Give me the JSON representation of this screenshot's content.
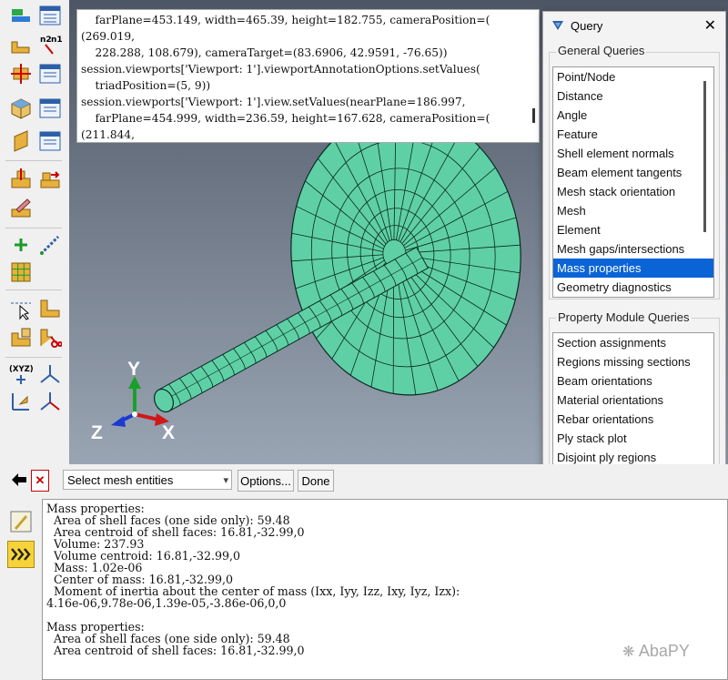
{
  "toolbox": {
    "tools": [
      {
        "icon": "bar-query-icon"
      },
      {
        "icon": "table-report-icon"
      },
      {
        "icon": "datum-csys-icon"
      },
      {
        "icon": "node-label-icon"
      },
      {
        "icon": "measure-point-icon"
      },
      {
        "icon": "table-report-icon"
      },
      {
        "icon": "cube-icon"
      },
      {
        "icon": "table-report-icon"
      },
      {
        "icon": "plate-icon"
      },
      {
        "icon": "table-report-icon"
      },
      {
        "icon": "edit-mesh-icon"
      },
      {
        "icon": "move-mesh-icon"
      },
      {
        "icon": "pencil-mesh-icon"
      },
      {
        "icon": "add-icon"
      },
      {
        "icon": "line-arrow-icon"
      },
      {
        "icon": "grid-mesh-icon"
      },
      {
        "icon": "select-region-icon"
      },
      {
        "icon": "partition-icon"
      },
      {
        "icon": "assign-icon"
      },
      {
        "icon": "cut-icon"
      },
      {
        "icon": "xyz-point-icon"
      },
      {
        "icon": "triad-icon"
      },
      {
        "icon": "axes-transform-icon"
      },
      {
        "icon": "triad-red-icon"
      }
    ],
    "node_label": "n2 n1"
  },
  "replay": {
    "lines": [
      "    farPlane=453.149, width=465.39, height=182.755, cameraPosition=(",
      "(269.019,",
      "    228.288, 108.679), cameraTarget=(83.6906, 42.9591, -76.65))",
      "session.viewports['Viewport: 1'].viewportAnnotationOptions.setValues(",
      "    triadPosition=(5, 9))",
      "session.viewports['Viewport: 1'].view.setValues(nearPlane=186.997,",
      "    farPlane=454.999, width=236.59, height=167.628, cameraPosition=(",
      "(211.844,"
    ]
  },
  "triad": {
    "y": "Y",
    "z": "Z",
    "x": "X"
  },
  "query_dialog": {
    "title": "Query",
    "close": "✕",
    "general_label": "General Queries",
    "general_items": [
      "Point/Node",
      "Distance",
      "Angle",
      "Feature",
      "Shell element normals",
      "Beam element tangents",
      "Mesh stack orientation",
      "Mesh",
      "Element",
      "Mesh gaps/intersections",
      "Mass properties",
      "Geometry diagnostics"
    ],
    "selected": "Mass properties",
    "property_label": "Property Module Queries",
    "property_items": [
      "Section assignments",
      "Regions missing sections",
      "Beam orientations",
      "Material orientations",
      "Rebar orientations",
      "Ply stack plot",
      "Disjoint ply regions"
    ]
  },
  "prompt": {
    "back": "🡸",
    "cancel": "✕",
    "select_value": "Select mesh entities",
    "options": "Options...",
    "done": "Done"
  },
  "messages": {
    "text": "Mass properties:\n  Area of shell faces (one side only): 59.48\n  Area centroid of shell faces: 16.81,-32.99,0\n  Volume: 237.93\n  Volume centroid: 16.81,-32.99,0\n  Mass: 1.02e-06\n  Center of mass: 16.81,-32.99,0\n  Moment of inertia about the center of mass (Ixx, Iyy, Izz, Ixy, Iyz, Izx):\n4.16e-06,9.78e-06,1.39e-05,-3.86e-06,0,0\n\nMass properties:\n  Area of shell faces (one side only): 59.48\n  Area centroid of shell faces: 16.81,-32.99,0"
  },
  "watermark": "AbaPY",
  "colors": {
    "mesh_fill": "#5fd0a6",
    "mesh_line": "#0a2a20",
    "accent": "#0a64d6"
  }
}
